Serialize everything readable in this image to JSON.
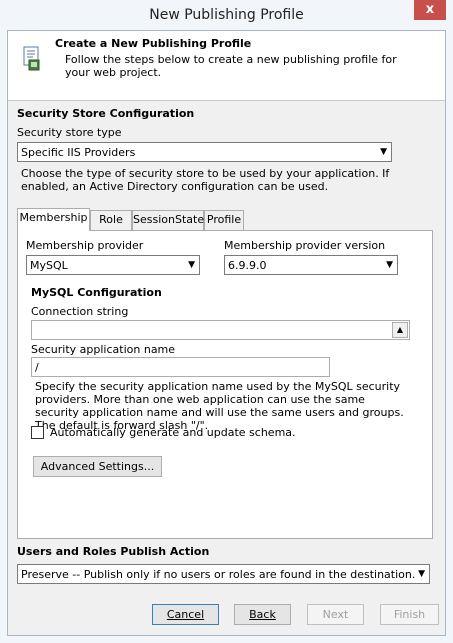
{
  "window": {
    "title": "New Publishing Profile",
    "close_glyph": "x"
  },
  "header": {
    "title": "Create a New Publishing Profile",
    "description": "Follow the steps below to create a new publishing profile for your web project.",
    "icon": "profile-document-icon"
  },
  "security_store": {
    "section_title": "Security Store Configuration",
    "type_label": "Security store type",
    "type_value": "Specific IIS Providers",
    "description": "Choose the type of security store to be used by your application. If enabled, an Active Directory configuration can be used."
  },
  "tabs": [
    {
      "label": "Membership",
      "active": true
    },
    {
      "label": "Role",
      "active": false
    },
    {
      "label": "SessionState",
      "active": false
    },
    {
      "label": "Profile",
      "active": false
    }
  ],
  "membership": {
    "provider_label": "Membership provider",
    "provider_value": "MySQL",
    "version_label": "Membership provider version",
    "version_value": "6.9.9.0",
    "config_title": "MySQL Configuration",
    "connection_label": "Connection string",
    "connection_value": "",
    "app_name_label": "Security application name",
    "app_name_value": "/",
    "app_name_description": "Specify the security application name used by the MySQL security providers. More than one web application can use the same security application name and will use the same users and groups. The default is forward slash \"/\".",
    "auto_schema_label": "Automatically generate and update schema.",
    "auto_schema_checked": false,
    "advanced_button": "Advanced Settings..."
  },
  "publish_action": {
    "section_title": "Users and Roles Publish Action",
    "value": "Preserve -- Publish only if no users or roles are found in the destination."
  },
  "buttons": {
    "cancel": "Cancel",
    "back": "Back",
    "next": "Next",
    "finish": "Finish"
  }
}
